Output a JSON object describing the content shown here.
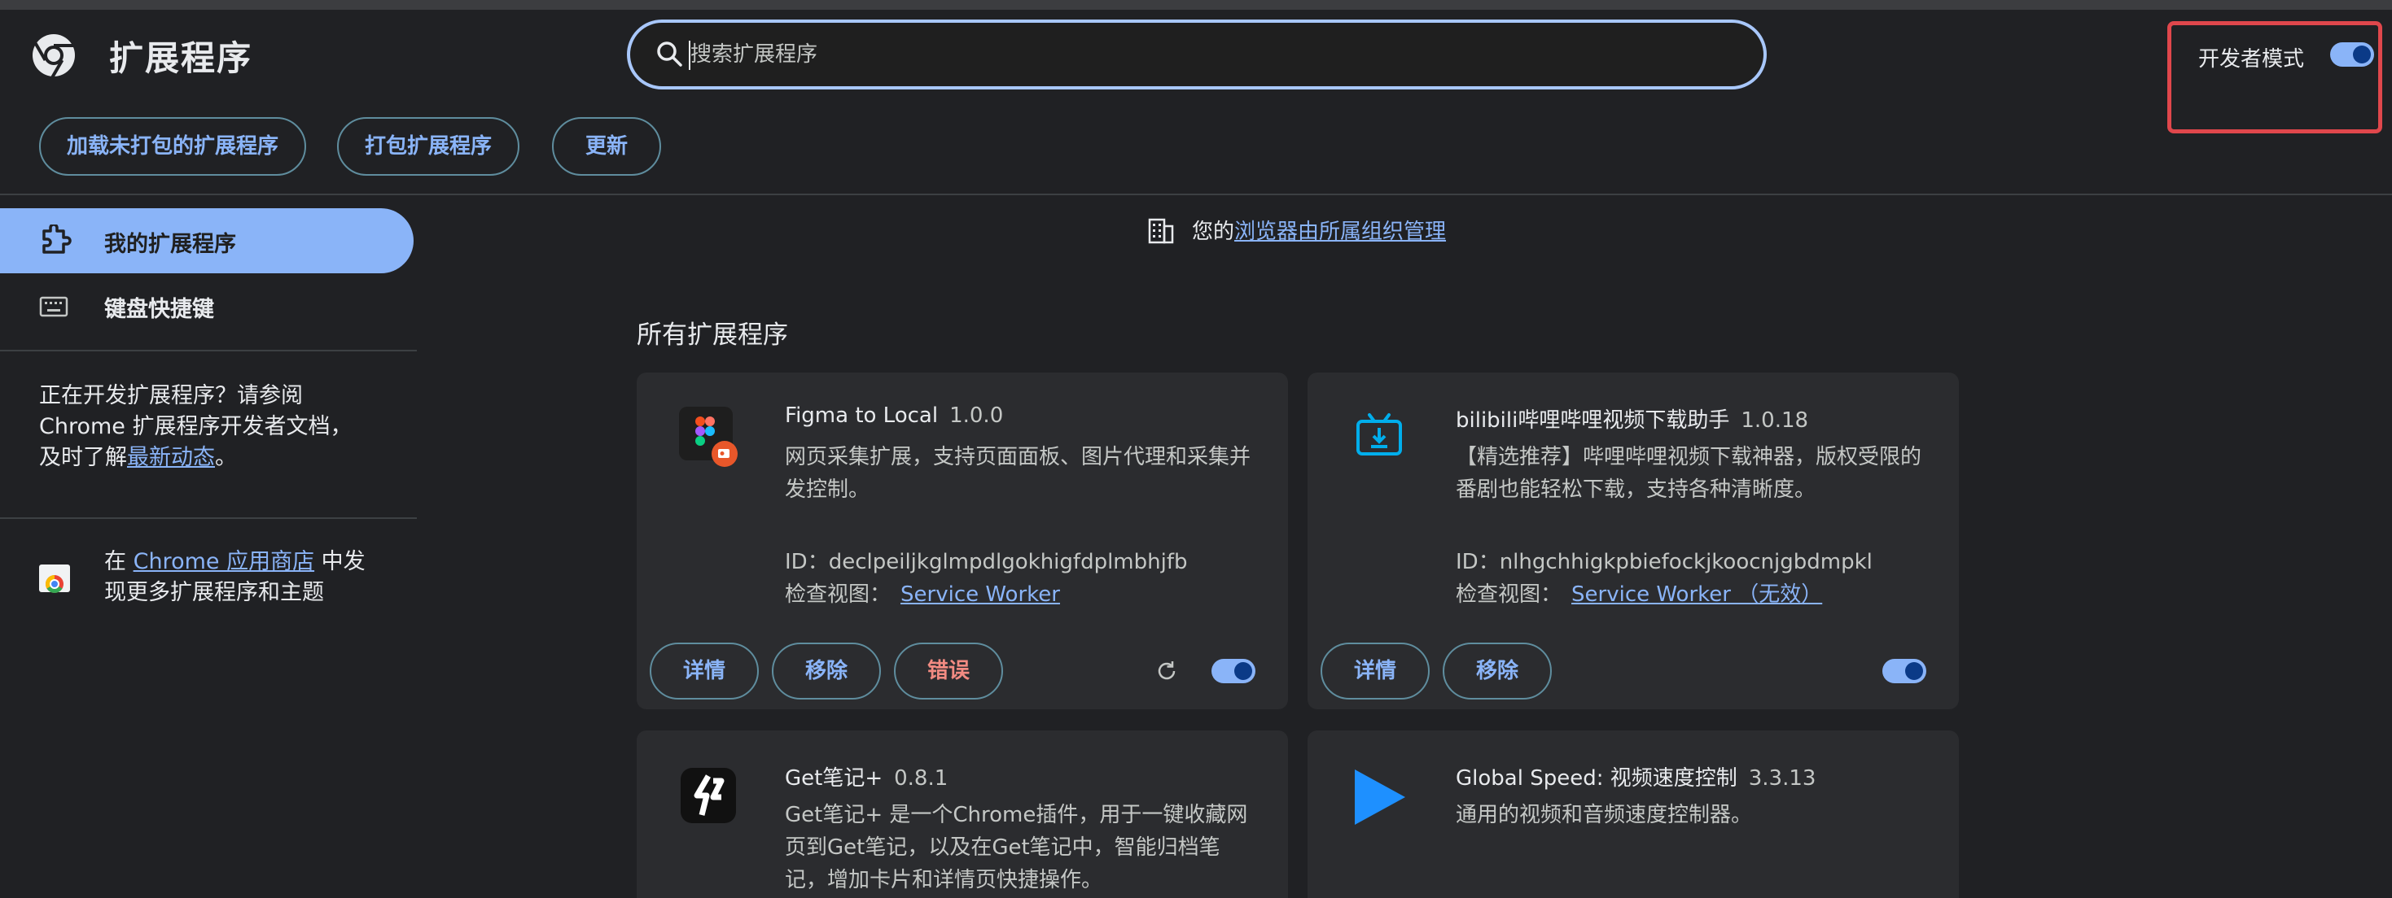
{
  "header": {
    "title": "扩展程序",
    "search_placeholder": "搜索扩展程序",
    "dev_mode_label": "开发者模式",
    "dev_mode_on": true
  },
  "toolbar": {
    "load_unpacked": "加载未打包的扩展程序",
    "pack": "打包扩展程序",
    "update": "更新"
  },
  "sidebar": {
    "items": [
      {
        "label": "我的扩展程序",
        "active": true,
        "icon": "puzzle-icon"
      },
      {
        "label": "键盘快捷键",
        "active": false,
        "icon": "keyboard-icon"
      }
    ],
    "dev_note_line1": "正在开发扩展程序？请参阅",
    "dev_note_line2": "Chrome 扩展程序开发者文档，",
    "dev_note_line3_prefix": "及时了解",
    "dev_note_link": "最新动态",
    "dev_note_line3_suffix": "。",
    "store_prefix": "在 ",
    "store_link": "Chrome 应用商店",
    "store_suffix": " 中发",
    "store_line2": "现更多扩展程序和主题"
  },
  "managed": {
    "prefix": "您的",
    "link": "浏览器由所属组织管理"
  },
  "section_title": "所有扩展程序",
  "extensions": [
    {
      "name": "Figma to Local",
      "version": "1.0.0",
      "desc": "网页采集扩展，支持页面面板、图片代理和采集并发控制。",
      "id_label": "ID：",
      "id": "declpeiljkglmpdlgokhigfdplmbhjfb",
      "inspect_label": "检查视图：",
      "inspect_link": "Service Worker",
      "details": "详情",
      "remove": "移除",
      "errors": "错误",
      "enabled": true
    },
    {
      "name": "bilibili哔哩哔哩视频下载助手",
      "version": "1.0.18",
      "desc": "【精选推荐】哔哩哔哩视频下载神器，版权受限的番剧也能轻松下载，支持各种清晰度。",
      "id_label": "ID：",
      "id": "nlhgchhigkpbiefockjkoocnjgbdmpkl",
      "inspect_label": "检查视图：",
      "inspect_link": "Service Worker （无效）",
      "details": "详情",
      "remove": "移除",
      "enabled": true
    },
    {
      "name": "Get笔记+",
      "version": "0.8.1",
      "desc": "Get笔记+ 是一个Chrome插件，用于一键收藏网页到Get笔记，以及在Get笔记中，智能归档笔记，增加卡片和详情页快捷操作。"
    },
    {
      "name": "Global Speed: 视频速度控制",
      "version": "3.3.13",
      "desc": "通用的视频和音频速度控制器。"
    }
  ],
  "colors": {
    "accent": "#8ab4f8",
    "background": "#202124",
    "card": "#2b2c2f",
    "highlight_box": "#e0474c",
    "error_text": "#f28b82"
  }
}
